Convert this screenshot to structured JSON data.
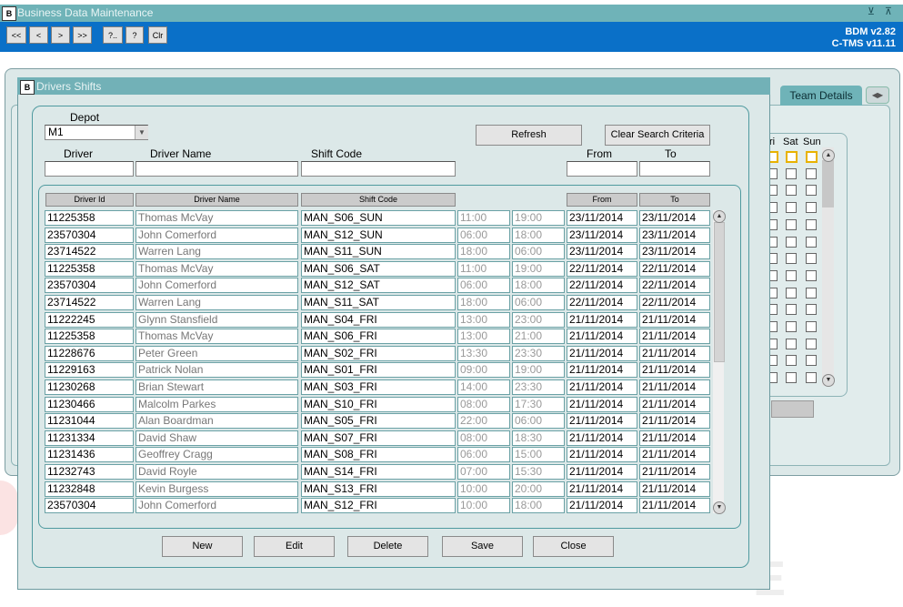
{
  "app": {
    "title": "Business Data Maintenance",
    "version_line1": "BDM v2.82",
    "version_line2": "C-TMS v11.11",
    "window_controls": "⊻ ⊼",
    "toolbar": [
      {
        "id": "first",
        "label": "<<"
      },
      {
        "id": "prev",
        "label": "<"
      },
      {
        "id": "next",
        "label": ">"
      },
      {
        "id": "last",
        "label": ">>"
      },
      {
        "id": "query",
        "label": "?.."
      },
      {
        "id": "help",
        "label": "?"
      },
      {
        "id": "clear",
        "label": "Clr"
      }
    ]
  },
  "background": {
    "team_tab": "Team Details",
    "day_labels": [
      "ri",
      "Sat",
      "Sun"
    ]
  },
  "dialog": {
    "title": "Drivers Shifts",
    "depot_label": "Depot",
    "depot_value": "M1",
    "driver_label": "Driver",
    "driver_name_label": "Driver Name",
    "shift_code_label": "Shift Code",
    "from_label": "From",
    "to_label": "To",
    "refresh_button": "Refresh",
    "clear_button": "Clear Search Criteria",
    "grid_headers": [
      "Driver Id",
      "Driver Name",
      "Shift Code",
      "From",
      "To"
    ],
    "rows": [
      [
        "11225358",
        "Thomas McVay",
        "MAN_S06_SUN",
        "11:00",
        "19:00",
        "23/11/2014",
        "23/11/2014"
      ],
      [
        "23570304",
        "John Comerford",
        "MAN_S12_SUN",
        "06:00",
        "18:00",
        "23/11/2014",
        "23/11/2014"
      ],
      [
        "23714522",
        "Warren Lang",
        "MAN_S11_SUN",
        "18:00",
        "06:00",
        "23/11/2014",
        "23/11/2014"
      ],
      [
        "11225358",
        "Thomas McVay",
        "MAN_S06_SAT",
        "11:00",
        "19:00",
        "22/11/2014",
        "22/11/2014"
      ],
      [
        "23570304",
        "John Comerford",
        "MAN_S12_SAT",
        "06:00",
        "18:00",
        "22/11/2014",
        "22/11/2014"
      ],
      [
        "23714522",
        "Warren Lang",
        "MAN_S11_SAT",
        "18:00",
        "06:00",
        "22/11/2014",
        "22/11/2014"
      ],
      [
        "11222245",
        "Glynn Stansfield",
        "MAN_S04_FRI",
        "13:00",
        "23:00",
        "21/11/2014",
        "21/11/2014"
      ],
      [
        "11225358",
        "Thomas McVay",
        "MAN_S06_FRI",
        "13:00",
        "21:00",
        "21/11/2014",
        "21/11/2014"
      ],
      [
        "11228676",
        "Peter Green",
        "MAN_S02_FRI",
        "13:30",
        "23:30",
        "21/11/2014",
        "21/11/2014"
      ],
      [
        "11229163",
        "Patrick Nolan",
        "MAN_S01_FRI",
        "09:00",
        "19:00",
        "21/11/2014",
        "21/11/2014"
      ],
      [
        "11230268",
        "Brian Stewart",
        "MAN_S03_FRI",
        "14:00",
        "23:30",
        "21/11/2014",
        "21/11/2014"
      ],
      [
        "11230466",
        "Malcolm Parkes",
        "MAN_S10_FRI",
        "08:00",
        "17:30",
        "21/11/2014",
        "21/11/2014"
      ],
      [
        "11231044",
        "Alan Boardman",
        "MAN_S05_FRI",
        "22:00",
        "06:00",
        "21/11/2014",
        "21/11/2014"
      ],
      [
        "11231334",
        "David Shaw",
        "MAN_S07_FRI",
        "08:00",
        "18:30",
        "21/11/2014",
        "21/11/2014"
      ],
      [
        "11231436",
        "Geoffrey Cragg",
        "MAN_S08_FRI",
        "06:00",
        "15:00",
        "21/11/2014",
        "21/11/2014"
      ],
      [
        "11232743",
        "David Royle",
        "MAN_S14_FRI",
        "07:00",
        "15:30",
        "21/11/2014",
        "21/11/2014"
      ],
      [
        "11232848",
        "Kevin Burgess",
        "MAN_S13_FRI",
        "10:00",
        "20:00",
        "21/11/2014",
        "21/11/2014"
      ],
      [
        "23570304",
        "John Comerford",
        "MAN_S12_FRI",
        "10:00",
        "18:00",
        "21/11/2014",
        "21/11/2014"
      ]
    ],
    "buttons": [
      {
        "id": "new",
        "label": "New"
      },
      {
        "id": "edit",
        "label": "Edit"
      },
      {
        "id": "delete",
        "label": "Delete"
      },
      {
        "id": "save",
        "label": "Save"
      },
      {
        "id": "close",
        "label": "Close"
      }
    ]
  }
}
